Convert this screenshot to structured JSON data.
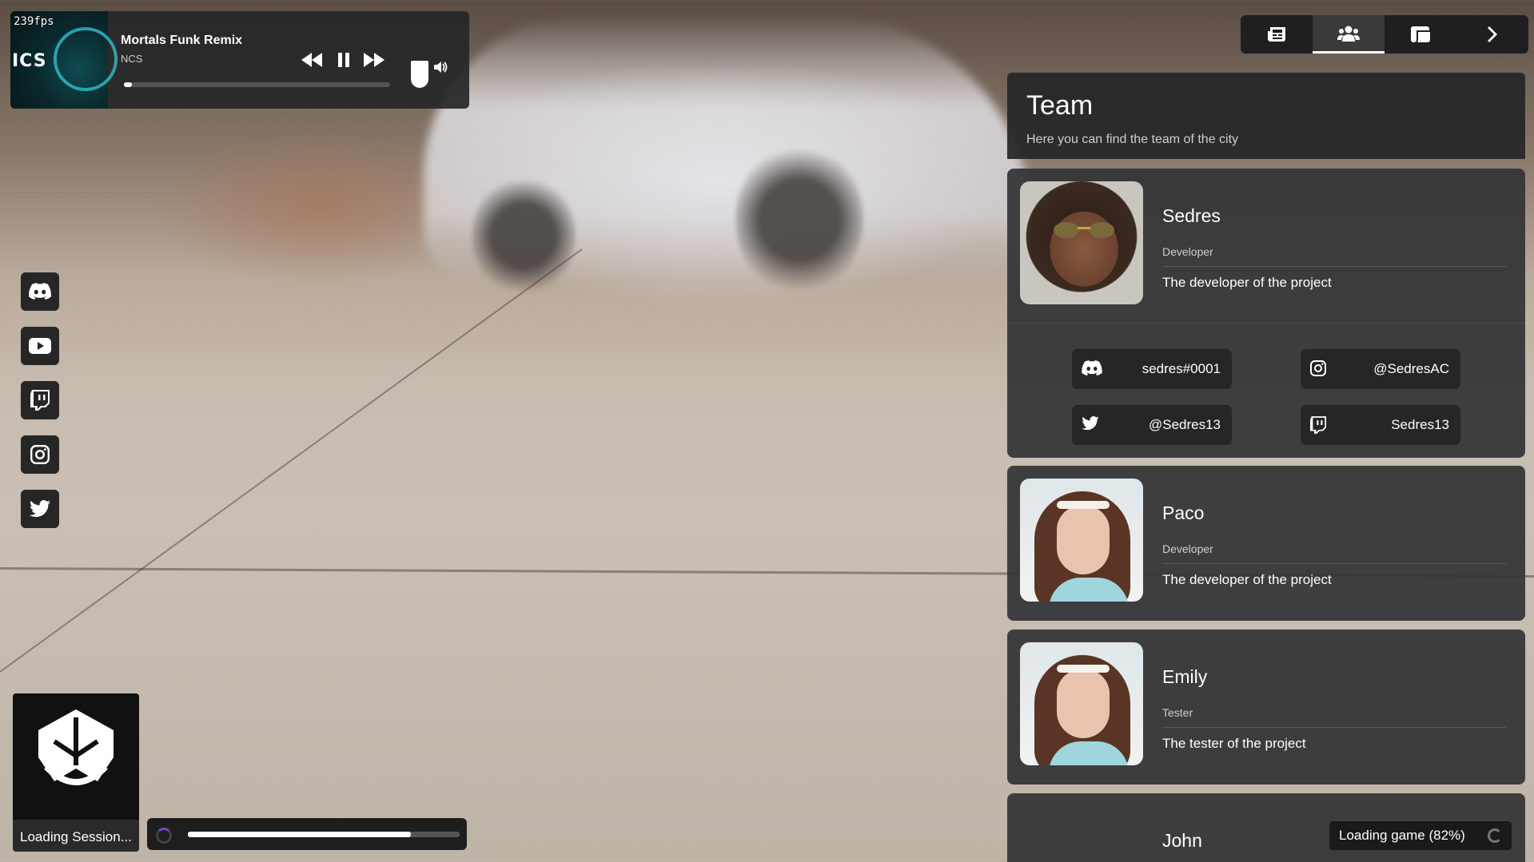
{
  "overlay": {
    "fps": "239fps"
  },
  "player": {
    "cover_text": "ICS",
    "title": "Mortals Funk Remix",
    "artist": "NCS",
    "progress": 0.03,
    "volume": 1.0
  },
  "social_links": [
    {
      "icon": "discord-icon"
    },
    {
      "icon": "youtube-icon"
    },
    {
      "icon": "twitch-icon"
    },
    {
      "icon": "instagram-icon"
    },
    {
      "icon": "twitter-icon"
    }
  ],
  "loading": {
    "session_text": "Loading Session...",
    "session_progress": 0.82,
    "game_text": "Loading game (82%)"
  },
  "nav": {
    "tabs": [
      {
        "icon": "news-icon",
        "active": false
      },
      {
        "icon": "team-icon",
        "active": true
      },
      {
        "icon": "rules-icon",
        "active": false
      },
      {
        "icon": "chevron-right-icon",
        "active": false
      }
    ]
  },
  "team": {
    "title": "Team",
    "subtitle": "Here you can find the team of the city",
    "members": [
      {
        "name": "Sedres",
        "role": "Developer",
        "description": "The developer of the project",
        "socials": {
          "discord": "sedres#0001",
          "instagram": "@SedresAC",
          "twitter": "@Sedres13",
          "twitch": "Sedres13"
        }
      },
      {
        "name": "Paco",
        "role": "Developer",
        "description": "The developer of the project"
      },
      {
        "name": "Emily",
        "role": "Tester",
        "description": "The tester of the project"
      },
      {
        "name": "John"
      }
    ]
  },
  "colors": {
    "panel_bg": "#262628",
    "card_bg": "#343436",
    "chip_bg": "#262626",
    "accent_spinner": "#6b4dc4"
  }
}
